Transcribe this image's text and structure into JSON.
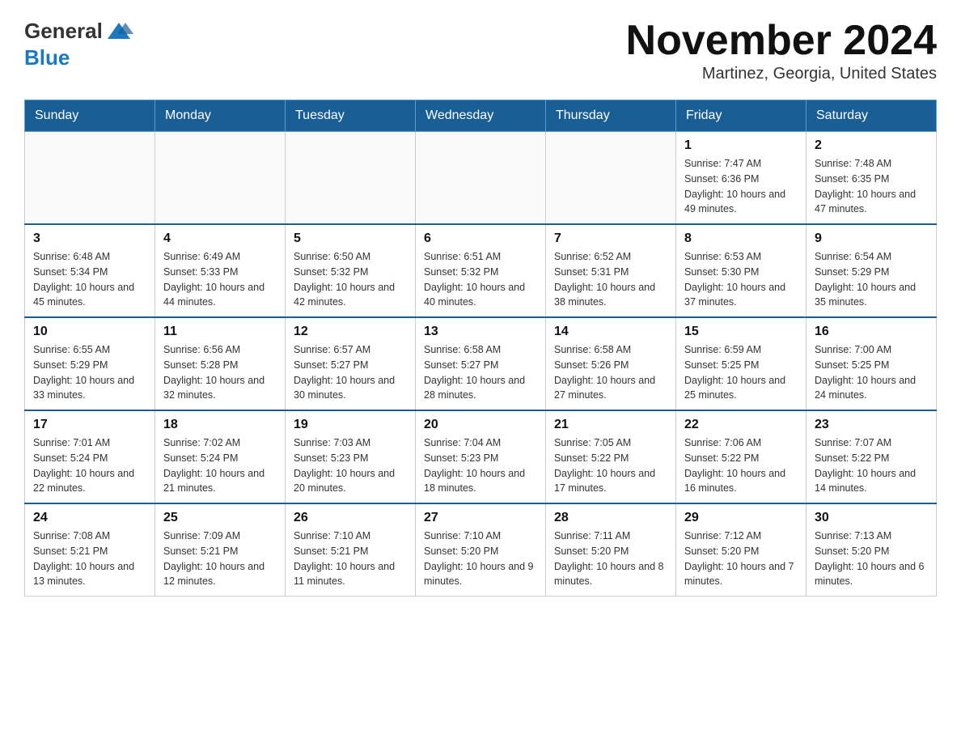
{
  "header": {
    "logo_general": "General",
    "logo_blue": "Blue",
    "title": "November 2024",
    "location": "Martinez, Georgia, United States"
  },
  "weekdays": [
    "Sunday",
    "Monday",
    "Tuesday",
    "Wednesday",
    "Thursday",
    "Friday",
    "Saturday"
  ],
  "weeks": [
    [
      {
        "day": "",
        "info": ""
      },
      {
        "day": "",
        "info": ""
      },
      {
        "day": "",
        "info": ""
      },
      {
        "day": "",
        "info": ""
      },
      {
        "day": "",
        "info": ""
      },
      {
        "day": "1",
        "info": "Sunrise: 7:47 AM\nSunset: 6:36 PM\nDaylight: 10 hours and 49 minutes."
      },
      {
        "day": "2",
        "info": "Sunrise: 7:48 AM\nSunset: 6:35 PM\nDaylight: 10 hours and 47 minutes."
      }
    ],
    [
      {
        "day": "3",
        "info": "Sunrise: 6:48 AM\nSunset: 5:34 PM\nDaylight: 10 hours and 45 minutes."
      },
      {
        "day": "4",
        "info": "Sunrise: 6:49 AM\nSunset: 5:33 PM\nDaylight: 10 hours and 44 minutes."
      },
      {
        "day": "5",
        "info": "Sunrise: 6:50 AM\nSunset: 5:32 PM\nDaylight: 10 hours and 42 minutes."
      },
      {
        "day": "6",
        "info": "Sunrise: 6:51 AM\nSunset: 5:32 PM\nDaylight: 10 hours and 40 minutes."
      },
      {
        "day": "7",
        "info": "Sunrise: 6:52 AM\nSunset: 5:31 PM\nDaylight: 10 hours and 38 minutes."
      },
      {
        "day": "8",
        "info": "Sunrise: 6:53 AM\nSunset: 5:30 PM\nDaylight: 10 hours and 37 minutes."
      },
      {
        "day": "9",
        "info": "Sunrise: 6:54 AM\nSunset: 5:29 PM\nDaylight: 10 hours and 35 minutes."
      }
    ],
    [
      {
        "day": "10",
        "info": "Sunrise: 6:55 AM\nSunset: 5:29 PM\nDaylight: 10 hours and 33 minutes."
      },
      {
        "day": "11",
        "info": "Sunrise: 6:56 AM\nSunset: 5:28 PM\nDaylight: 10 hours and 32 minutes."
      },
      {
        "day": "12",
        "info": "Sunrise: 6:57 AM\nSunset: 5:27 PM\nDaylight: 10 hours and 30 minutes."
      },
      {
        "day": "13",
        "info": "Sunrise: 6:58 AM\nSunset: 5:27 PM\nDaylight: 10 hours and 28 minutes."
      },
      {
        "day": "14",
        "info": "Sunrise: 6:58 AM\nSunset: 5:26 PM\nDaylight: 10 hours and 27 minutes."
      },
      {
        "day": "15",
        "info": "Sunrise: 6:59 AM\nSunset: 5:25 PM\nDaylight: 10 hours and 25 minutes."
      },
      {
        "day": "16",
        "info": "Sunrise: 7:00 AM\nSunset: 5:25 PM\nDaylight: 10 hours and 24 minutes."
      }
    ],
    [
      {
        "day": "17",
        "info": "Sunrise: 7:01 AM\nSunset: 5:24 PM\nDaylight: 10 hours and 22 minutes."
      },
      {
        "day": "18",
        "info": "Sunrise: 7:02 AM\nSunset: 5:24 PM\nDaylight: 10 hours and 21 minutes."
      },
      {
        "day": "19",
        "info": "Sunrise: 7:03 AM\nSunset: 5:23 PM\nDaylight: 10 hours and 20 minutes."
      },
      {
        "day": "20",
        "info": "Sunrise: 7:04 AM\nSunset: 5:23 PM\nDaylight: 10 hours and 18 minutes."
      },
      {
        "day": "21",
        "info": "Sunrise: 7:05 AM\nSunset: 5:22 PM\nDaylight: 10 hours and 17 minutes."
      },
      {
        "day": "22",
        "info": "Sunrise: 7:06 AM\nSunset: 5:22 PM\nDaylight: 10 hours and 16 minutes."
      },
      {
        "day": "23",
        "info": "Sunrise: 7:07 AM\nSunset: 5:22 PM\nDaylight: 10 hours and 14 minutes."
      }
    ],
    [
      {
        "day": "24",
        "info": "Sunrise: 7:08 AM\nSunset: 5:21 PM\nDaylight: 10 hours and 13 minutes."
      },
      {
        "day": "25",
        "info": "Sunrise: 7:09 AM\nSunset: 5:21 PM\nDaylight: 10 hours and 12 minutes."
      },
      {
        "day": "26",
        "info": "Sunrise: 7:10 AM\nSunset: 5:21 PM\nDaylight: 10 hours and 11 minutes."
      },
      {
        "day": "27",
        "info": "Sunrise: 7:10 AM\nSunset: 5:20 PM\nDaylight: 10 hours and 9 minutes."
      },
      {
        "day": "28",
        "info": "Sunrise: 7:11 AM\nSunset: 5:20 PM\nDaylight: 10 hours and 8 minutes."
      },
      {
        "day": "29",
        "info": "Sunrise: 7:12 AM\nSunset: 5:20 PM\nDaylight: 10 hours and 7 minutes."
      },
      {
        "day": "30",
        "info": "Sunrise: 7:13 AM\nSunset: 5:20 PM\nDaylight: 10 hours and 6 minutes."
      }
    ]
  ]
}
